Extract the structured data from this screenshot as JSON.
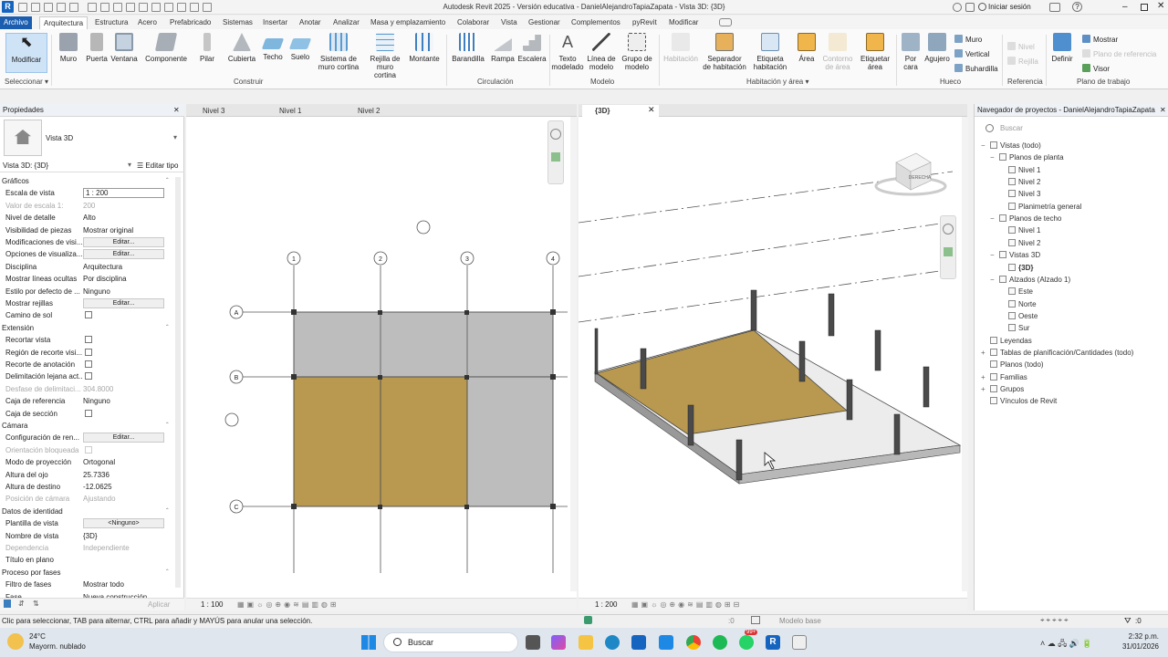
{
  "window": {
    "title": "Autodesk Revit 2025 - Versión educativa - DanielAlejandroTapiaZapata - Vista 3D: {3D}",
    "signin": "Iniciar sesión"
  },
  "tabs": [
    "Archivo",
    "Arquitectura",
    "Estructura",
    "Acero",
    "Prefabricado",
    "Sistemas",
    "Insertar",
    "Anotar",
    "Analizar",
    "Masa y emplazamiento",
    "Colaborar",
    "Vista",
    "Gestionar",
    "Complementos",
    "pyRevit",
    "Modificar"
  ],
  "ribbon": {
    "modificar": "Modificar",
    "seleccionar": "Seleccionar",
    "muro": "Muro",
    "puerta": "Puerta",
    "ventana": "Ventana",
    "componente": "Componente",
    "pilar": "Pilar",
    "cubierta": "Cubierta",
    "techo": "Techo",
    "suelo": "Suelo",
    "sistema_cortina_1": "Sistema de",
    "sistema_cortina_2": "muro cortina",
    "rejilla_1": "Rejilla de",
    "rejilla_2": "muro cortina",
    "montante": "Montante",
    "construir": "Construir",
    "barandilla": "Barandilla",
    "rampa": "Rampa",
    "escalera": "Escalera",
    "circulacion": "Circulación",
    "texto_1": "Texto",
    "texto_2": "modelado",
    "linea_1": "Línea de",
    "linea_2": "modelo",
    "grupo_1": "Grupo de",
    "grupo_2": "modelo",
    "modelo": "Modelo",
    "habitacion": "Habitación",
    "separador_1": "Separador",
    "separador_2": "de habitación",
    "etiqueta_hab_1": "Etiqueta",
    "etiqueta_hab_2": "habitación",
    "area": "Área",
    "contorno_1": "Contorno",
    "contorno_2": "de área",
    "etiqueta_area_1": "Etiquetar",
    "etiqueta_area_2": "área",
    "hab_area": "Habitación y área",
    "por_cara_1": "Por",
    "por_cara_2": "cara",
    "agujero": "Agujero",
    "hueco_muro": "Muro",
    "vertical": "Vertical",
    "buhardilla": "Buhardilla",
    "hueco": "Hueco",
    "nivel": "Nivel",
    "rejilla": "Rejilla",
    "referencia": "Referencia",
    "definir": "Definir",
    "mostrar": "Mostrar",
    "plano_ref": "Plano de referencia",
    "visor": "Visor",
    "plano_trabajo": "Plano de trabajo"
  },
  "properties": {
    "title": "Propiedades",
    "type_name": "Vista 3D",
    "instance": "Vista 3D: {3D}",
    "edit_type": "Editar tipo",
    "apply": "Aplicar",
    "rows": [
      {
        "kind": "sec",
        "k": "Gráficos"
      },
      {
        "kind": "input",
        "k": "Escala de vista",
        "v": "1 : 200"
      },
      {
        "kind": "text",
        "k": "Valor de escala    1:",
        "v": "200",
        "g": true
      },
      {
        "kind": "text",
        "k": "Nivel de detalle",
        "v": "Alto"
      },
      {
        "kind": "text",
        "k": "Visibilidad de piezas",
        "v": "Mostrar original"
      },
      {
        "kind": "btn",
        "k": "Modificaciones de visi...",
        "v": "Editar..."
      },
      {
        "kind": "btn",
        "k": "Opciones de visualiza...",
        "v": "Editar..."
      },
      {
        "kind": "text",
        "k": "Disciplina",
        "v": "Arquitectura"
      },
      {
        "kind": "text",
        "k": "Mostrar líneas ocultas",
        "v": "Por disciplina"
      },
      {
        "kind": "text",
        "k": "Estilo por defecto de ...",
        "v": "Ninguno"
      },
      {
        "kind": "btn",
        "k": "Mostrar rejillas",
        "v": "Editar..."
      },
      {
        "kind": "check",
        "k": "Camino de sol"
      },
      {
        "kind": "sec",
        "k": "Extensión"
      },
      {
        "kind": "check",
        "k": "Recortar vista"
      },
      {
        "kind": "check",
        "k": "Región de recorte visi..."
      },
      {
        "kind": "check",
        "k": "Recorte de anotación"
      },
      {
        "kind": "check",
        "k": "Delimitación lejana act..."
      },
      {
        "kind": "text",
        "k": "Desfase de delimitaci...",
        "v": "304.8000",
        "g": true
      },
      {
        "kind": "text",
        "k": "Caja de referencia",
        "v": "Ninguno"
      },
      {
        "kind": "check",
        "k": "Caja de sección"
      },
      {
        "kind": "sec",
        "k": "Cámara"
      },
      {
        "kind": "btn",
        "k": "Configuración de ren...",
        "v": "Editar..."
      },
      {
        "kind": "check",
        "k": "Orientación bloqueada",
        "g": true
      },
      {
        "kind": "text",
        "k": "Modo de proyección",
        "v": "Ortogonal"
      },
      {
        "kind": "text",
        "k": "Altura del ojo",
        "v": "25.7336"
      },
      {
        "kind": "text",
        "k": "Altura de destino",
        "v": "-12.0625"
      },
      {
        "kind": "text",
        "k": "Posición de cámara",
        "v": "Ajustando",
        "g": true
      },
      {
        "kind": "sec",
        "k": "Datos de identidad"
      },
      {
        "kind": "btn",
        "k": "Plantilla de vista",
        "v": "<Ninguno>"
      },
      {
        "kind": "text",
        "k": "Nombre de vista",
        "v": "{3D}"
      },
      {
        "kind": "text",
        "k": "Dependencia",
        "v": "Independiente",
        "g": true
      },
      {
        "kind": "text",
        "k": "Título en plano",
        "v": ""
      },
      {
        "kind": "sec",
        "k": "Proceso por fases"
      },
      {
        "kind": "text",
        "k": "Filtro de fases",
        "v": "Mostrar todo"
      },
      {
        "kind": "text",
        "k": "Fase",
        "v": "Nueva construcción"
      }
    ]
  },
  "plan_view": {
    "tabs": [
      "Nivel 3",
      "Nivel 1",
      "Nivel 2"
    ],
    "scale": "1 : 100",
    "grid_cols": [
      "1",
      "2",
      "3",
      "4"
    ],
    "grid_rows": [
      "A",
      "B",
      "C"
    ]
  },
  "view_3d": {
    "tab": "{3D}",
    "scale": "1 : 200",
    "viewcube_label": "DERECHA"
  },
  "navigator": {
    "title": "Navegador de proyectos - DanielAlejandroTapiaZapata",
    "search": "Buscar",
    "items": [
      {
        "t": "Vistas (todo)",
        "d": 0,
        "tog": "−"
      },
      {
        "t": "Planos de planta",
        "d": 1,
        "tog": "−"
      },
      {
        "t": "Nivel 1",
        "d": 2
      },
      {
        "t": "Nivel 2",
        "d": 2
      },
      {
        "t": "Nivel 3",
        "d": 2
      },
      {
        "t": "Planimetría general",
        "d": 2
      },
      {
        "t": "Planos de techo",
        "d": 1,
        "tog": "−"
      },
      {
        "t": "Nivel 1",
        "d": 2
      },
      {
        "t": "Nivel 2",
        "d": 2
      },
      {
        "t": "Vistas 3D",
        "d": 1,
        "tog": "−"
      },
      {
        "t": "{3D}",
        "d": 2,
        "bold": true
      },
      {
        "t": "Alzados (Alzado 1)",
        "d": 1,
        "tog": "−"
      },
      {
        "t": "Este",
        "d": 2
      },
      {
        "t": "Norte",
        "d": 2
      },
      {
        "t": "Oeste",
        "d": 2
      },
      {
        "t": "Sur",
        "d": 2
      },
      {
        "t": "Leyendas",
        "d": 0
      },
      {
        "t": "Tablas de planificación/Cantidades (todo)",
        "d": 0,
        "tog": "+"
      },
      {
        "t": "Planos (todo)",
        "d": 0
      },
      {
        "t": "Familias",
        "d": 0,
        "tog": "+"
      },
      {
        "t": "Grupos",
        "d": 0,
        "tog": "+"
      },
      {
        "t": "Vínculos de Revit",
        "d": 0
      }
    ]
  },
  "status": {
    "hint": "Clic para seleccionar, TAB para alternar, CTRL para añadir y MAYÚS para anular una selección.",
    "zero": ":0",
    "model": "Modelo base",
    "filter": ":0"
  },
  "taskbar": {
    "temp": "24°C",
    "weather": "Mayorm. nublado",
    "search": "Buscar",
    "time": "2:32 p.m.",
    "date": "31/01/2026",
    "badge": "99+"
  },
  "colors": {
    "accent": "#1b5eb0",
    "floor_gold": "#b9994f",
    "slab_gray": "#bdbdbd",
    "column": "#4a4a4a"
  }
}
